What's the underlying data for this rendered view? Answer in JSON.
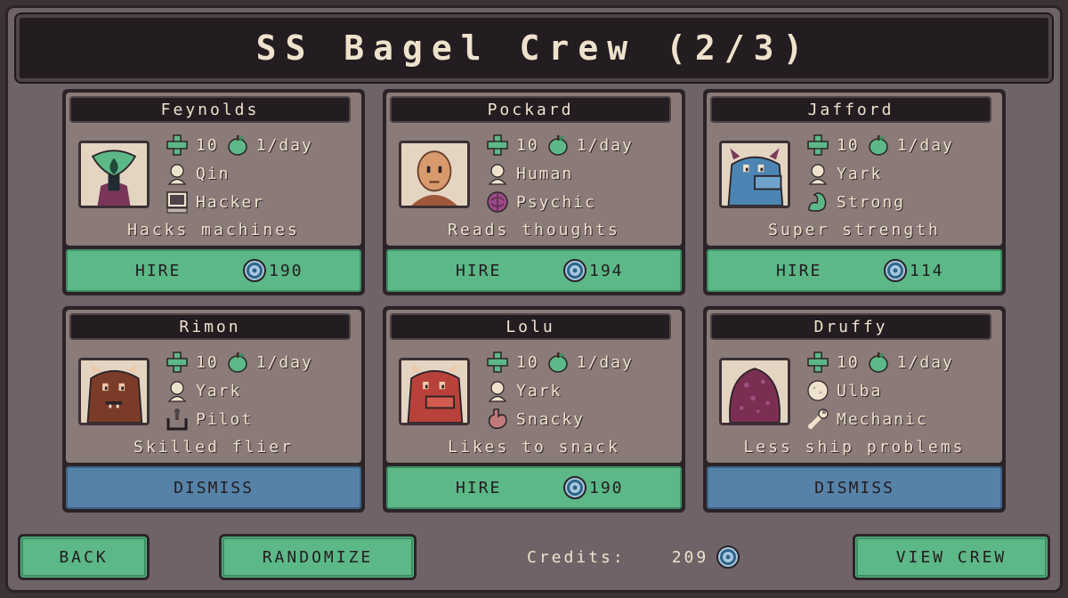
{
  "title": "SS Bagel Crew (2/3)",
  "colors": {
    "hire": "#5cb886",
    "dismiss": "#5682a8",
    "panel": "#8a7a78",
    "dark": "#231c21"
  },
  "cards": [
    {
      "name": "Feynolds",
      "health": "10",
      "food": "1/day",
      "species": "Qin",
      "role": "Hacker",
      "desc": "Hacks machines",
      "action": "HIRE",
      "cost": "190",
      "portrait": "qin-alien",
      "role_icon": "computer-icon"
    },
    {
      "name": "Pockard",
      "health": "10",
      "food": "1/day",
      "species": "Human",
      "role": "Psychic",
      "desc": "Reads thoughts",
      "action": "HIRE",
      "cost": "194",
      "portrait": "human",
      "role_icon": "brain-icon"
    },
    {
      "name": "Jafford",
      "health": "10",
      "food": "1/day",
      "species": "Yark",
      "role": "Strong",
      "desc": "Super strength",
      "action": "HIRE",
      "cost": "114",
      "portrait": "yark-blue",
      "role_icon": "muscle-icon"
    },
    {
      "name": "Rimon",
      "health": "10",
      "food": "1/day",
      "species": "Yark",
      "role": "Pilot",
      "desc": "Skilled flier",
      "action": "DISMISS",
      "cost": "",
      "portrait": "yark-brown",
      "role_icon": "joystick-icon"
    },
    {
      "name": "Lolu",
      "health": "10",
      "food": "1/day",
      "species": "Yark",
      "role": "Snacky",
      "desc": "Likes to snack",
      "action": "HIRE",
      "cost": "190",
      "portrait": "yark-red",
      "role_icon": "stomach-icon"
    },
    {
      "name": "Druffy",
      "health": "10",
      "food": "1/day",
      "species": "Ulba",
      "role": "Mechanic",
      "desc": "Less ship problems",
      "action": "DISMISS",
      "cost": "",
      "portrait": "ulba-blob",
      "role_icon": "wrench-icon"
    }
  ],
  "footer": {
    "back": "BACK",
    "randomize": "RANDOMIZE",
    "credits_label": "Credits:",
    "credits_amount": "209",
    "view_crew": "VIEW CREW"
  }
}
